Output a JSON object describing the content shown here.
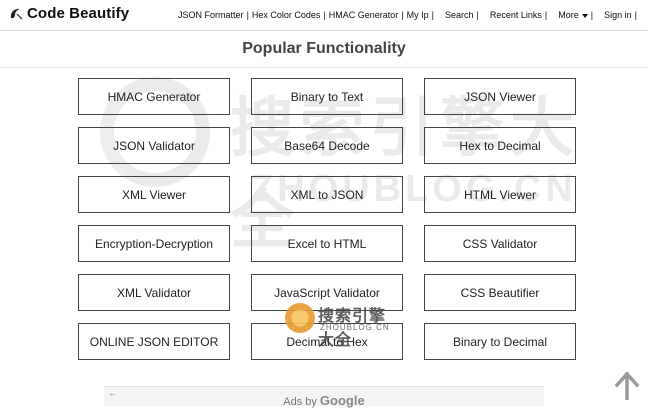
{
  "header": {
    "logo_text": "Code Beautify",
    "nav": [
      "JSON Formatter",
      "Hex Color Codes",
      "HMAC Generator",
      "My Ip",
      "Search",
      "Recent Links",
      "More",
      "Sign in"
    ]
  },
  "main": {
    "heading": "Popular Functionality",
    "tools": [
      "HMAC Generator",
      "Binary to Text",
      "JSON Viewer",
      "JSON Validator",
      "Base64 Decode",
      "Hex to Decimal",
      "XML Viewer",
      "XML to JSON",
      "HTML Viewer",
      "Encryption-Decryption",
      "Excel to HTML",
      "CSS Validator",
      "XML Validator",
      "JavaScript Validator",
      "CSS Beautifier",
      "ONLINE JSON EDITOR",
      "Decimal to Hex",
      "Binary to Decimal"
    ]
  },
  "watermark": {
    "cn": "搜索引擎大全",
    "latin": "ZHOUBLOG.CN",
    "small_cn": "搜索引擎大全",
    "small_latin": "ZHOUBLOG.CN"
  },
  "ad": {
    "label": "Ads by",
    "brand": "Google"
  },
  "icons": {
    "logo": "code-beautify-logo-icon",
    "scroll_top": "arrow-up-icon",
    "ad_back": "back-arrow-icon"
  }
}
